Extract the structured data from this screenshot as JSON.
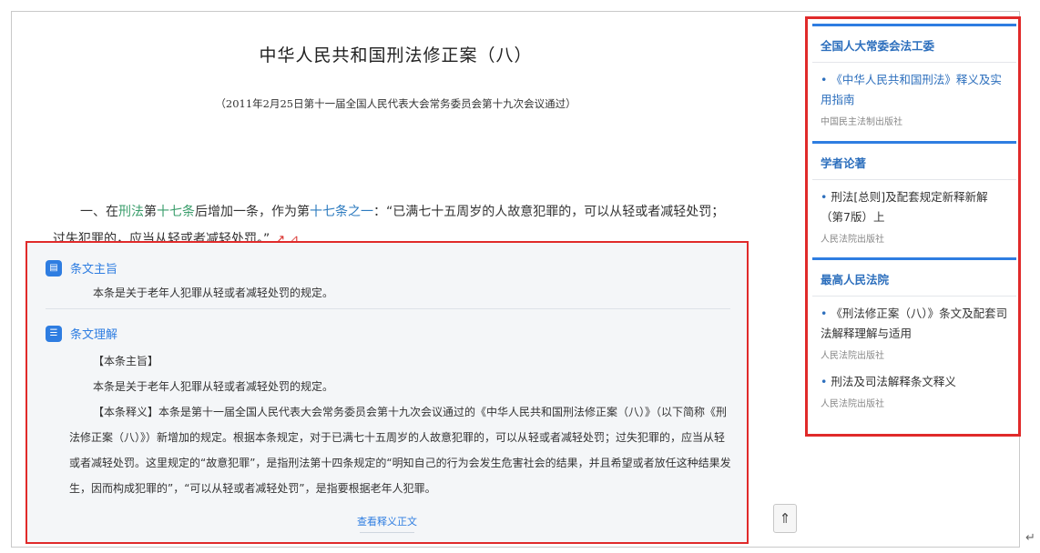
{
  "document": {
    "title": "中华人民共和国刑法修正案（八）",
    "subtitle": "（2011年2月25日第十一届全国人民代表大会常务委员会第十九次会议通过）"
  },
  "article": {
    "part1": "一、在",
    "law_link": "刑法",
    "part2": "第",
    "article_link": "十七条",
    "part3": "后增加一条，作为第",
    "new_article_link": "十七条之一",
    "part4": "：“已满七十五周岁的人故意犯罪的，可以从轻或者减轻处罚；过失犯罪的，应当从轻或者减轻处罚。”",
    "tag_icon": "trend-icon"
  },
  "interpretation": {
    "summary": {
      "label": "条文主旨",
      "icon": "document-icon",
      "text": "本条是关于老年人犯罪从轻或者减轻处罚的规定。"
    },
    "understanding": {
      "label": "条文理解",
      "icon": "list-icon",
      "heading1": "【本条主旨】",
      "text1": "本条是关于老年人犯罪从轻或者减轻处罚的规定。",
      "body": "【本条释义】本条是第十一届全国人民代表大会常务委员会第十九次会议通过的《中华人民共和国刑法修正案（八）》（以下简称《刑法修正案（八）》）新增加的规定。根据本条规定，对于已满七十五周岁的人故意犯罪的，可以从轻或者减轻处罚；过失犯罪的，应当从轻或者减轻处罚。这里规定的“故意犯罪”，是指刑法第十四条规定的“明知自己的行为会发生危害社会的结果，并且希望或者放任这种结果发生，因而构成犯罪的”，“可以从轻或者减轻处罚”，是指要根据老年人犯罪。"
    },
    "more_link": "查看释义正文"
  },
  "back_to_top_icon": "arrow-up-icon",
  "sidebar": {
    "sections": [
      {
        "title": "全国人大常委会法工委",
        "items": [
          {
            "title": "《中华人民共和国刑法》释义及实用指南",
            "source": "中国民主法制出版社",
            "style": "link"
          }
        ]
      },
      {
        "title": "学者论著",
        "items": [
          {
            "title": "刑法[总则]及配套规定新释新解（第7版）上",
            "source": "人民法院出版社",
            "style": "dark"
          }
        ]
      },
      {
        "title": "最高人民法院",
        "items": [
          {
            "title": "《刑法修正案（八）》条文及配套司法解释理解与适用",
            "source": "人民法院出版社",
            "style": "dark"
          },
          {
            "title": "刑法及司法解释条文释义",
            "source": "人民法院出版社",
            "style": "dark"
          }
        ]
      }
    ]
  },
  "corner_mark": "↵"
}
